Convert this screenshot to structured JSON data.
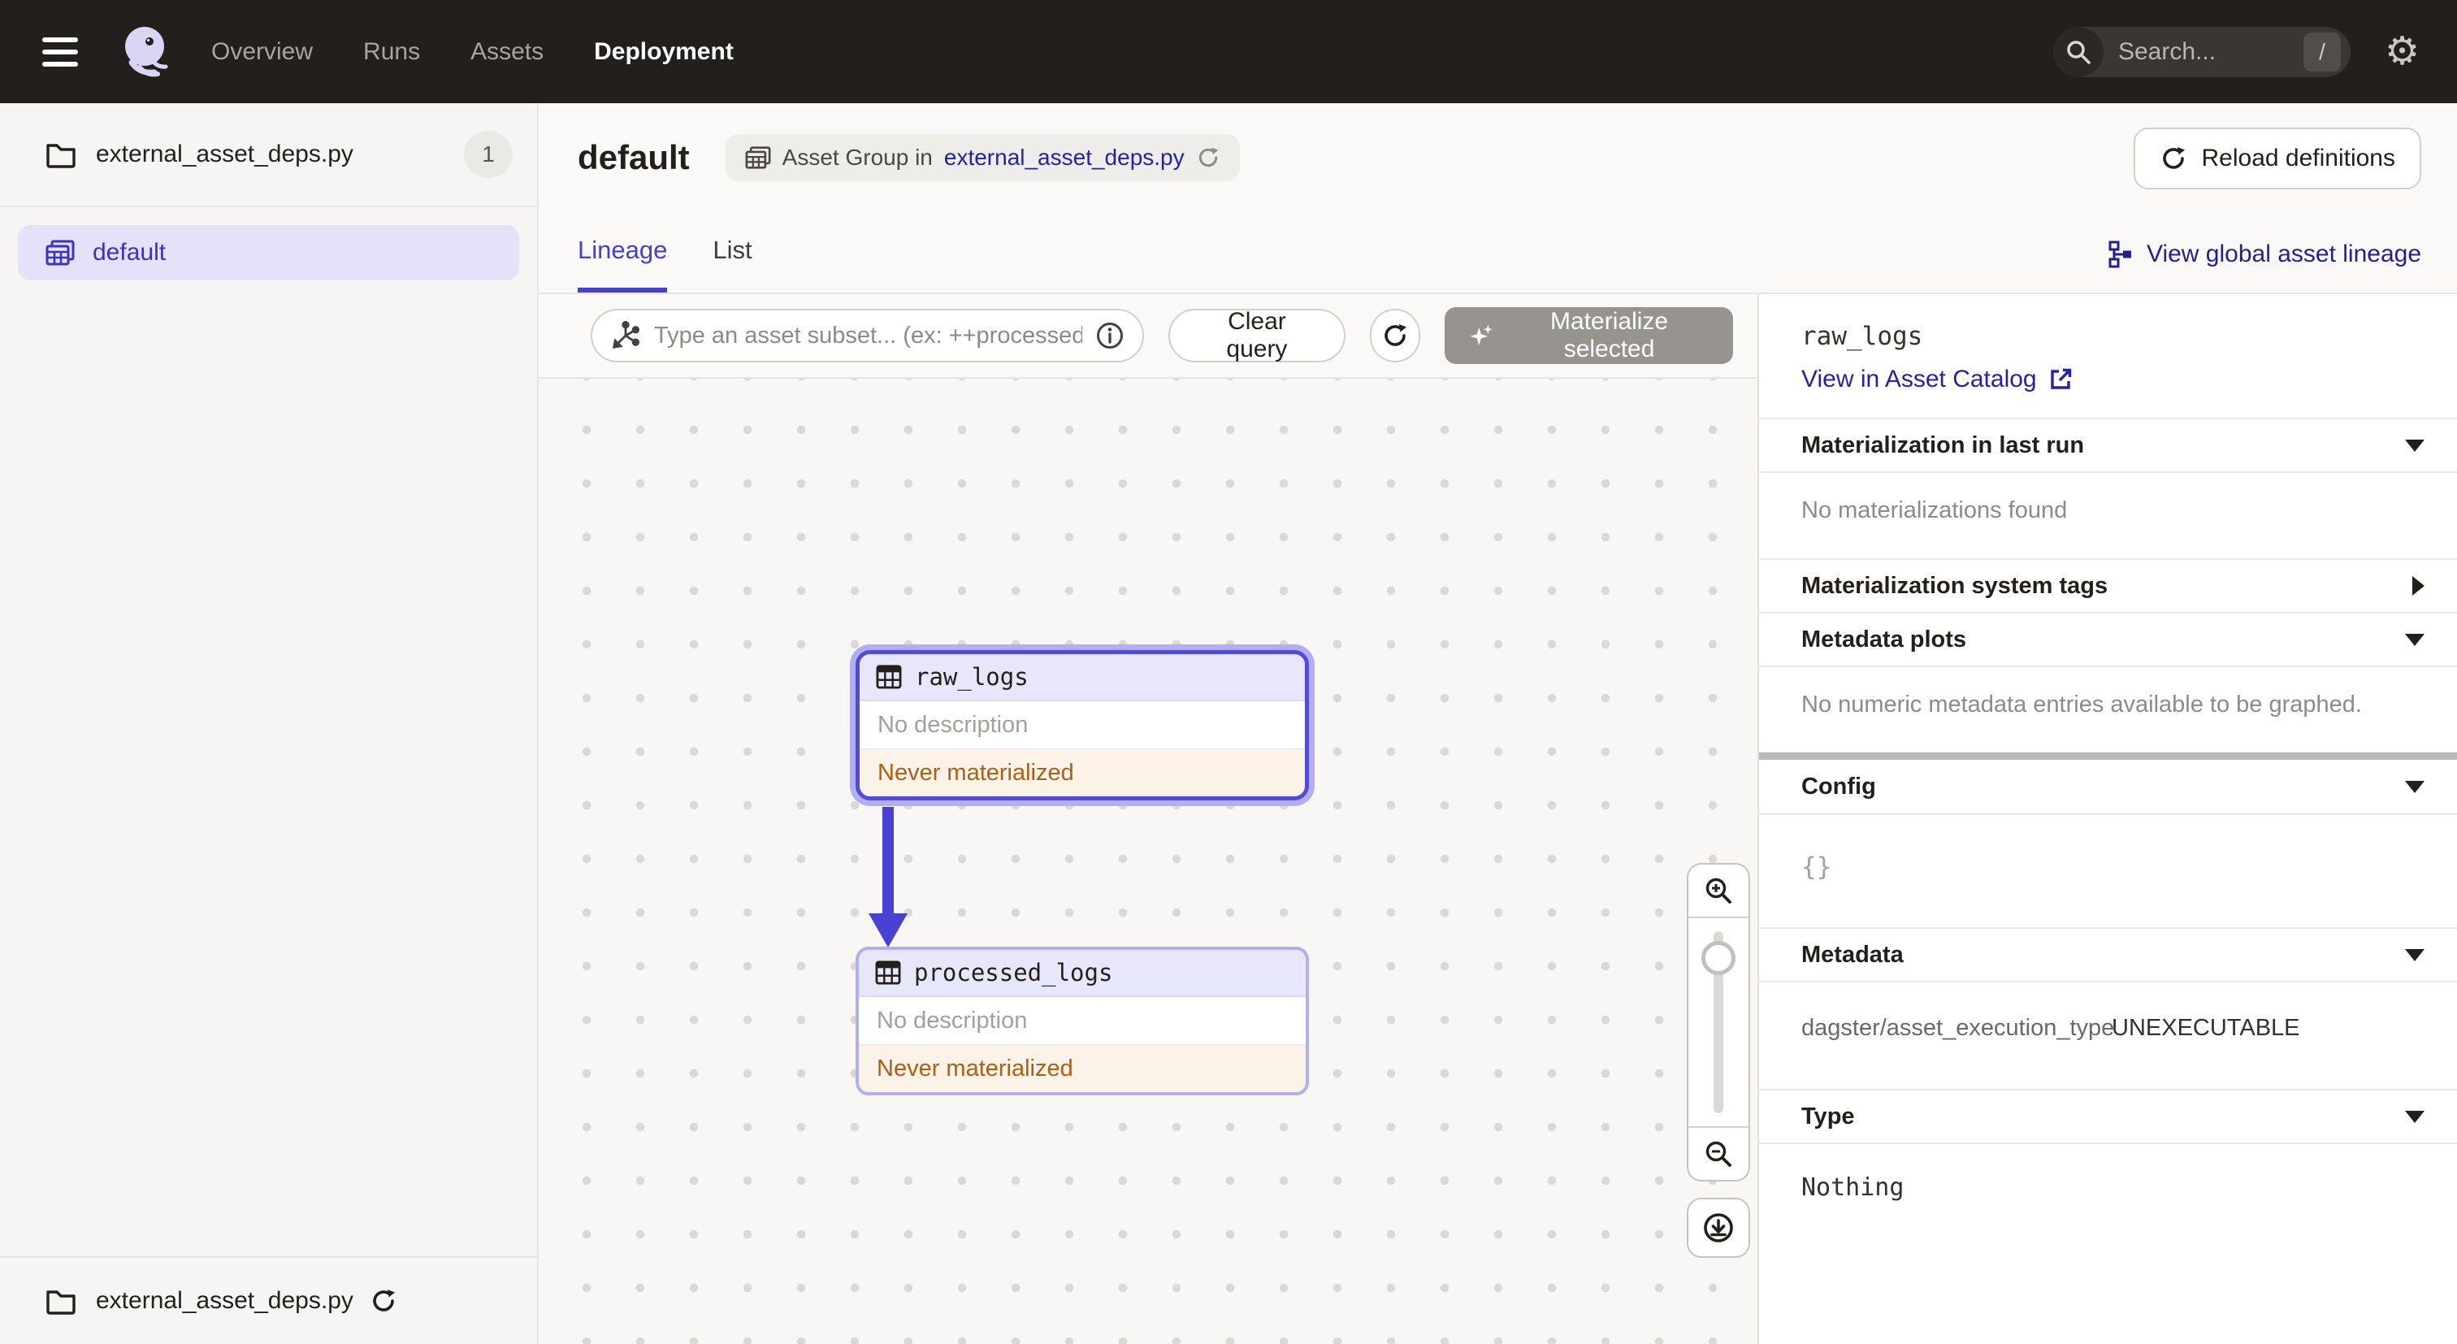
{
  "nav": {
    "items": [
      {
        "label": "Overview"
      },
      {
        "label": "Runs"
      },
      {
        "label": "Assets"
      },
      {
        "label": "Deployment"
      }
    ],
    "search": {
      "placeholder": "Search...",
      "shortcut": "/"
    }
  },
  "sidebar": {
    "repo": {
      "label": "external_asset_deps.py",
      "count": "1"
    },
    "items": [
      {
        "label": "default"
      }
    ],
    "footer": {
      "label": "external_asset_deps.py"
    }
  },
  "header": {
    "title": "default",
    "group_chip": {
      "prefix": "Asset Group in",
      "link": "external_asset_deps.py"
    },
    "reload_button": "Reload definitions"
  },
  "tabs": {
    "items": [
      {
        "label": "Lineage"
      },
      {
        "label": "List"
      }
    ],
    "global_lineage_link": "View global asset lineage"
  },
  "toolbar": {
    "query_placeholder": "Type an asset subset... (ex: ++processed_logs",
    "clear_button": "Clear query",
    "materialize_button": "Materialize selected"
  },
  "graph": {
    "nodes": [
      {
        "name": "raw_logs",
        "description": "No description",
        "status": "Never materialized"
      },
      {
        "name": "processed_logs",
        "description": "No description",
        "status": "Never materialized"
      }
    ]
  },
  "panel": {
    "title": "raw_logs",
    "catalog_link": "View in Asset Catalog",
    "sections": {
      "materialization": {
        "header": "Materialization in last run",
        "empty": "No materializations found"
      },
      "system_tags": {
        "header": "Materialization system tags"
      },
      "metadata_plots": {
        "header": "Metadata plots",
        "empty": "No numeric metadata entries available to be graphed."
      },
      "config": {
        "header": "Config",
        "value": "{}"
      },
      "metadata": {
        "header": "Metadata",
        "key": "dagster/asset_execution_type",
        "value": "UNEXECUTABLE"
      },
      "type": {
        "header": "Type",
        "value": "Nothing"
      }
    }
  },
  "colors": {
    "accent": "#4f43dd",
    "link": "#2721a8",
    "never_materialized_text": "#b05e13",
    "never_materialized_bg": "#fbf2e8",
    "selected_item_bg": "#e4e1f8"
  }
}
